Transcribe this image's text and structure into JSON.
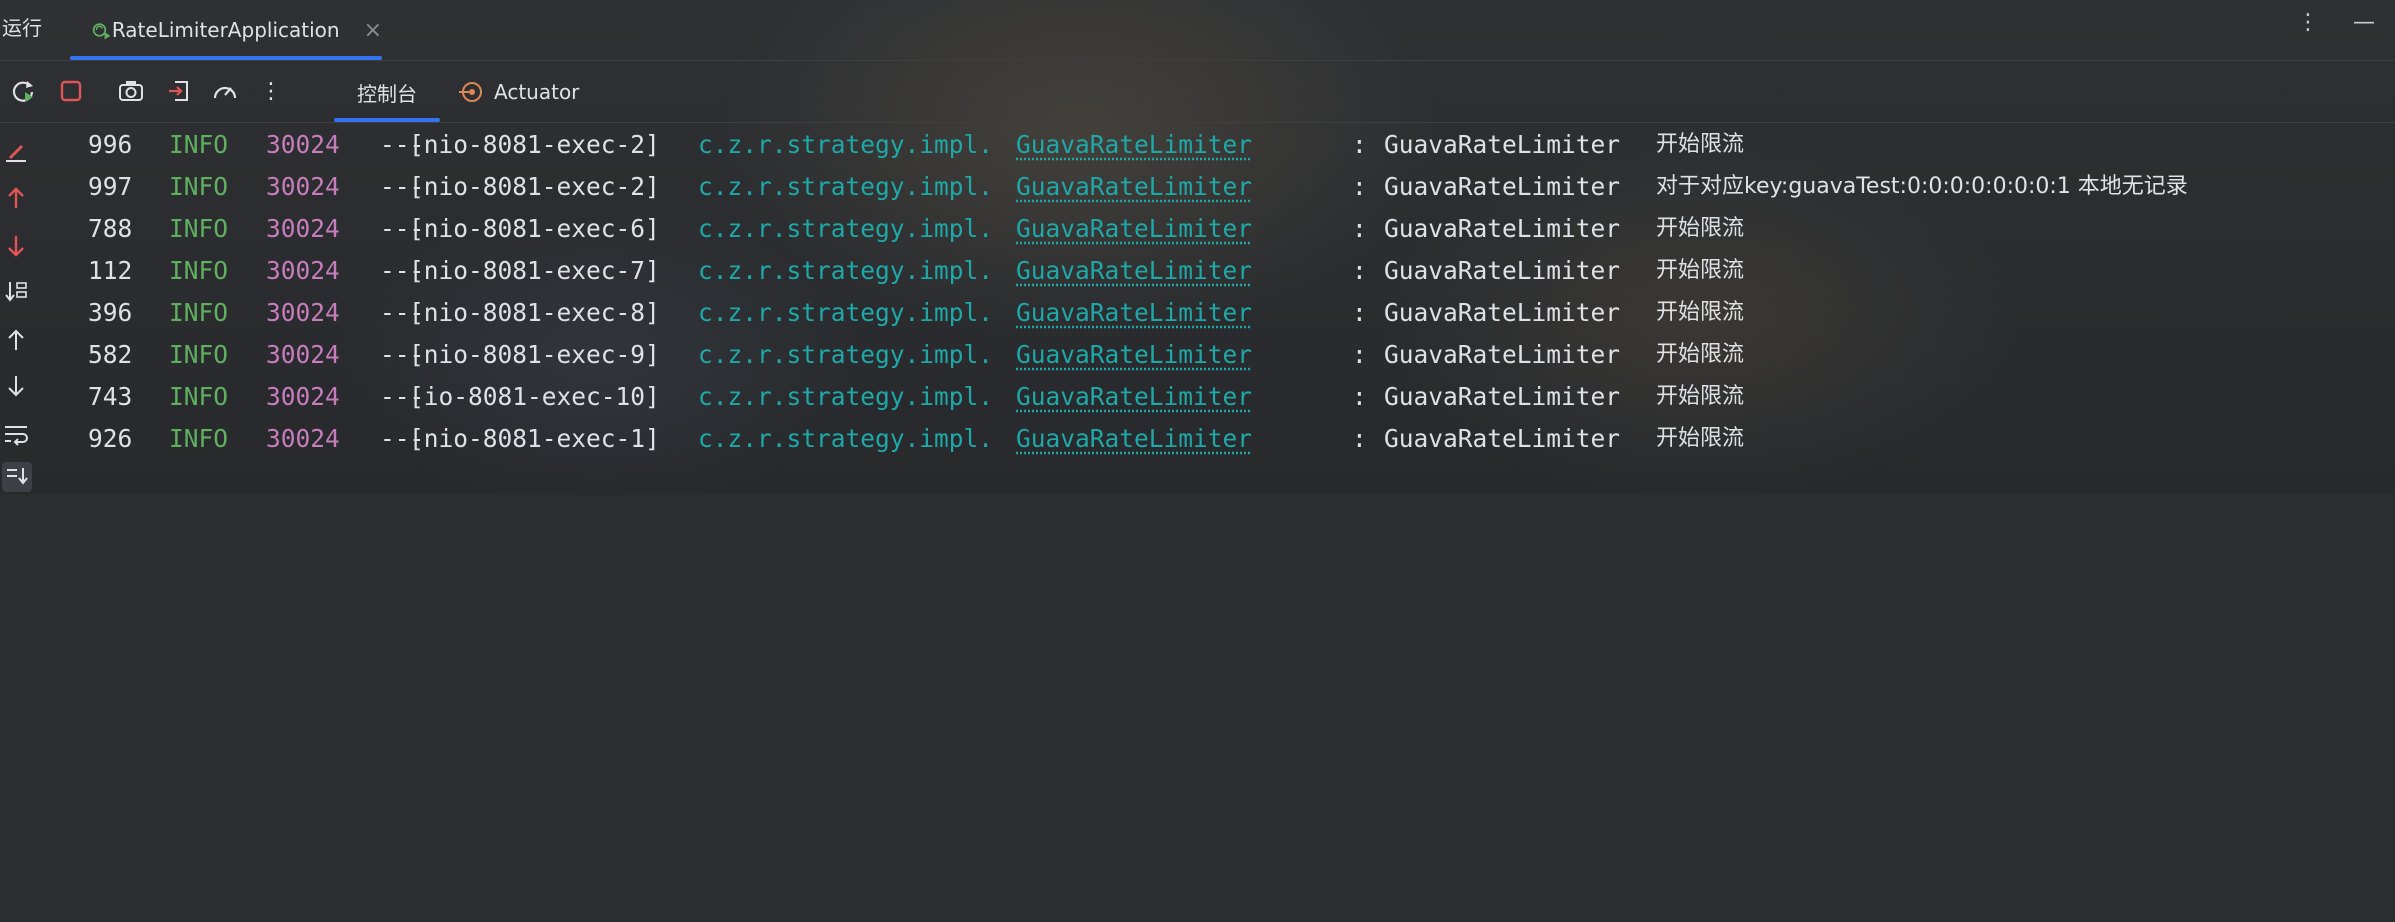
{
  "topbar": {
    "run_label": "运行",
    "tab_label": "RateLimiterApplication",
    "tab_close": "×",
    "more": "⋮",
    "minimize": "—"
  },
  "toolbar": {
    "console_tab": "控制台",
    "actuator_tab": "Actuator",
    "more": "⋮"
  },
  "colors": {
    "accent": "#3574f0",
    "info": "#5fb05f",
    "pid": "#c77dbb",
    "logger": "#1fa8a8",
    "stop": "#e05555",
    "rerun": "#5fb05f"
  },
  "log_lines": [
    {
      "num": "996",
      "level": "INFO",
      "pid": "30024",
      "sep": "---",
      "thread": "[nio-8081-exec-2]",
      "pkg": "c.z.r.strategy.impl.",
      "cls": "GuavaRateLimiter",
      "colon": ":",
      "msg": "GuavaRateLimiter",
      "cn": "开始限流"
    },
    {
      "num": "997",
      "level": "INFO",
      "pid": "30024",
      "sep": "---",
      "thread": "[nio-8081-exec-2]",
      "pkg": "c.z.r.strategy.impl.",
      "cls": "GuavaRateLimiter",
      "colon": ":",
      "msg": "GuavaRateLimiter",
      "cn": "对于对应key:guavaTest:0:0:0:0:0:0:0:1 本地无记录"
    },
    {
      "num": "788",
      "level": "INFO",
      "pid": "30024",
      "sep": "---",
      "thread": "[nio-8081-exec-6]",
      "pkg": "c.z.r.strategy.impl.",
      "cls": "GuavaRateLimiter",
      "colon": ":",
      "msg": "GuavaRateLimiter",
      "cn": "开始限流"
    },
    {
      "num": "112",
      "level": "INFO",
      "pid": "30024",
      "sep": "---",
      "thread": "[nio-8081-exec-7]",
      "pkg": "c.z.r.strategy.impl.",
      "cls": "GuavaRateLimiter",
      "colon": ":",
      "msg": "GuavaRateLimiter",
      "cn": "开始限流"
    },
    {
      "num": "396",
      "level": "INFO",
      "pid": "30024",
      "sep": "---",
      "thread": "[nio-8081-exec-8]",
      "pkg": "c.z.r.strategy.impl.",
      "cls": "GuavaRateLimiter",
      "colon": ":",
      "msg": "GuavaRateLimiter",
      "cn": "开始限流"
    },
    {
      "num": "582",
      "level": "INFO",
      "pid": "30024",
      "sep": "---",
      "thread": "[nio-8081-exec-9]",
      "pkg": "c.z.r.strategy.impl.",
      "cls": "GuavaRateLimiter",
      "colon": ":",
      "msg": "GuavaRateLimiter",
      "cn": "开始限流"
    },
    {
      "num": "743",
      "level": "INFO",
      "pid": "30024",
      "sep": "---",
      "thread": "[io-8081-exec-10]",
      "pkg": "c.z.r.strategy.impl.",
      "cls": "GuavaRateLimiter",
      "colon": ":",
      "msg": "GuavaRateLimiter",
      "cn": "开始限流"
    },
    {
      "num": "926",
      "level": "INFO",
      "pid": "30024",
      "sep": "---",
      "thread": "[nio-8081-exec-1]",
      "pkg": "c.z.r.strategy.impl.",
      "cls": "GuavaRateLimiter",
      "colon": ":",
      "msg": "GuavaRateLimiter",
      "cn": "开始限流"
    }
  ]
}
